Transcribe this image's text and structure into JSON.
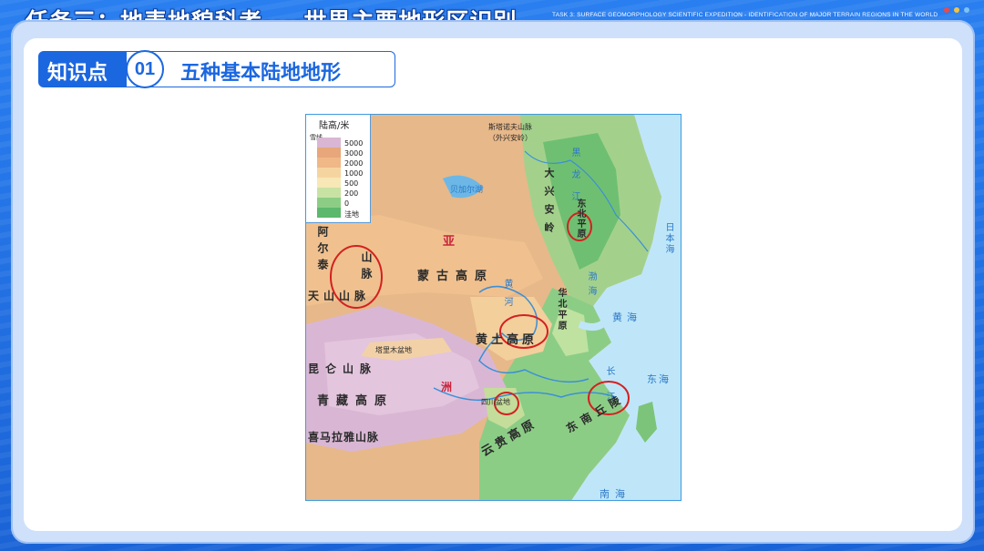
{
  "header": {
    "title": "任务三：地表地貌科考----世界主要地形区识别",
    "subtitle_en": "TASK 3: SURFACE GEOMORPHOLOGY SCIENTIFIC EXPEDITION - IDENTIFICATION OF MAJOR TERRAIN REGIONS IN THE WORLD",
    "window_dots": [
      "#e94b4b",
      "#f5c242",
      "#7ec3f5"
    ]
  },
  "section": {
    "label": "知识点",
    "number": "01",
    "title": "五种基本陆地地形"
  },
  "map": {
    "legend": {
      "title": "陆高/米",
      "snow_label": "雪线",
      "levels": [
        "5000",
        "3000",
        "2000",
        "1000",
        "500",
        "200",
        "0",
        "洼地"
      ],
      "colors": [
        "#d9b7d4",
        "#e7a77a",
        "#f0b787",
        "#f6d4a0",
        "#f7e8b6",
        "#c8e2a3",
        "#8ccd86",
        "#5cb86d"
      ]
    },
    "labels": {
      "xing_an_top": "斯塔诺夫山脉",
      "xing_an_top2": "（外兴安岭）",
      "baikal": "贝加尔湖",
      "altai": "阿尔泰",
      "shanmai": "山脉",
      "tianshan": "天山山脉",
      "ya": "亚",
      "mongolia": "蒙古高原",
      "da_xing_an": "大兴安岭",
      "heilong": "黑龙江",
      "dongbei": "东北平原",
      "japan_sea": "日本海",
      "bohai": "渤海",
      "huabei": "华北平原",
      "huanghe": "黄河",
      "loess": "黄土高原",
      "yellow_sea": "黄海",
      "tarim": "塔里木盆地",
      "kunlun": "昆仑山脉",
      "qingzang": "青藏高原",
      "zhou": "洲",
      "sichuan": "四川盆地",
      "changjiang": "长江",
      "east_sea": "东海",
      "dongnan": "东南丘陵",
      "himalaya": "喜马拉雅山脉",
      "yungui": "云贵高原",
      "south_sea": "南海"
    }
  }
}
